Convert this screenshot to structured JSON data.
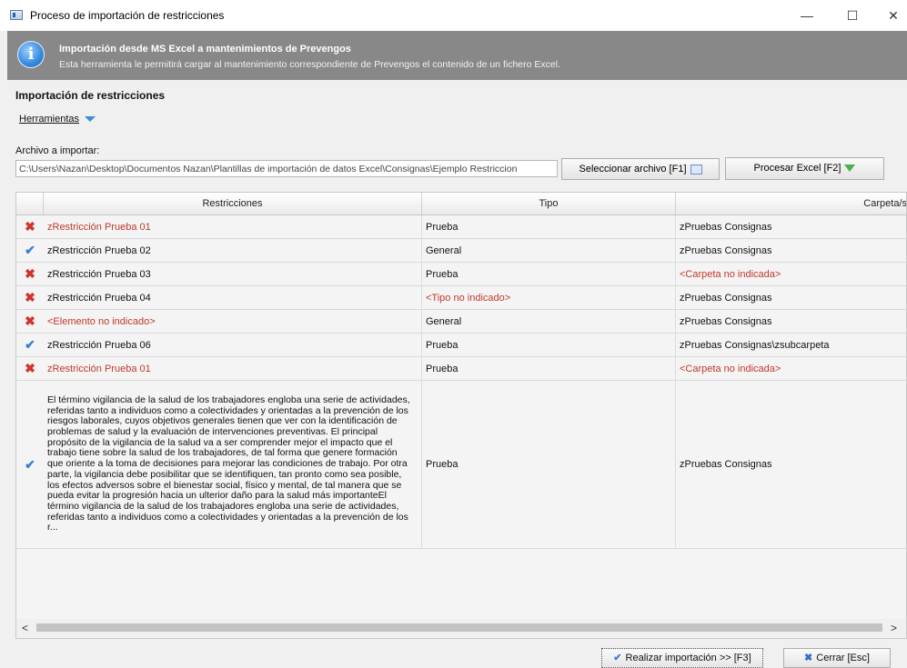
{
  "window": {
    "title": "Proceso de importación de restricciones",
    "minimize": "—",
    "maximize": "☐",
    "close": "✕"
  },
  "banner": {
    "title": "Importación desde MS Excel a mantenimientos de Prevengos",
    "subtitle": "Esta herramienta le permitirá cargar al mantenimiento correspondiente de Prevengos el contenido de un fichero Excel."
  },
  "section_title": "Importación de restricciones",
  "tools": {
    "menu_label": "Herramientas"
  },
  "file": {
    "label": "Archivo a importar:",
    "path": "C:\\Users\\Nazan\\Desktop\\Documentos Nazan\\Plantillas de importación de datos Excel\\Consignas\\Ejemplo Restriccion"
  },
  "buttons": {
    "select": "Seleccionar archivo [F1]",
    "process": "Procesar Excel [F2]",
    "import": "Realizar importación >> [F3]",
    "close": "Cerrar [Esc]"
  },
  "grid": {
    "columns": [
      "Restricciones",
      "Tipo",
      "Carpeta/s"
    ],
    "rows": [
      {
        "status": "error",
        "restriccion": "zRestricción Prueba 01",
        "tipo": "Prueba",
        "carpeta": "zPruebas Consignas",
        "r_red": true,
        "t_red": false,
        "f_red": false
      },
      {
        "status": "ok",
        "restriccion": "zRestricción Prueba 02",
        "tipo": "General",
        "carpeta": "zPruebas Consignas",
        "r_red": false,
        "t_red": false,
        "f_red": false
      },
      {
        "status": "error",
        "restriccion": "zRestricción Prueba 03",
        "tipo": "Prueba",
        "carpeta": "<Carpeta no indicada>",
        "r_red": false,
        "t_red": false,
        "f_red": true
      },
      {
        "status": "error",
        "restriccion": "zRestricción Prueba 04",
        "tipo": "<Tipo no indicado>",
        "carpeta": "zPruebas Consignas",
        "r_red": false,
        "t_red": true,
        "f_red": false
      },
      {
        "status": "error",
        "restriccion": "<Elemento no indicado>",
        "tipo": "General",
        "carpeta": "zPruebas Consignas",
        "r_red": true,
        "t_red": false,
        "f_red": false
      },
      {
        "status": "ok",
        "restriccion": "zRestricción Prueba 06",
        "tipo": "Prueba",
        "carpeta": "zPruebas Consignas\\zsubcarpeta",
        "r_red": false,
        "t_red": false,
        "f_red": false
      },
      {
        "status": "error",
        "restriccion": "zRestricción Prueba 01",
        "tipo": "Prueba",
        "carpeta": "<Carpeta no indicada>",
        "r_red": true,
        "t_red": false,
        "f_red": true
      },
      {
        "status": "ok",
        "restriccion": "El término vigilancia de la salud de los trabajadores engloba una serie de actividades, referidas tanto a individuos como a colectividades y orientadas a la prevención de los riesgos laborales, cuyos objetivos generales tienen que ver con la identificación de problemas de salud y la evaluación de intervenciones preventivas. El principal propósito de la vigilancia de la salud va a ser comprender mejor el impacto que el trabajo tiene sobre la salud de los trabajadores, de tal forma que genere formación que oriente a la toma de decisiones para mejorar las condiciones de trabajo. Por otra parte, la vigilancia debe posibilitar que se identifiquen, tan pronto como sea posible, los efectos adversos sobre el bienestar social, físico y mental, de tal manera que se pueda evitar la progresión hacia un ulterior daño para la salud más importanteEl término vigilancia de la salud de los trabajadores engloba una serie de actividades, referidas tanto a individuos como a colectividades y orientadas a la prevención de los r...",
        "tipo": "Prueba",
        "carpeta": "zPruebas Consignas",
        "r_red": false,
        "t_red": false,
        "f_red": false
      }
    ]
  },
  "icons": {
    "error": "x-icon",
    "ok": "check-icon",
    "info": "info-icon"
  },
  "colors": {
    "error_text": "#c0392b",
    "banner_bg": "#888888",
    "accent_blue": "#3a7fd4"
  }
}
